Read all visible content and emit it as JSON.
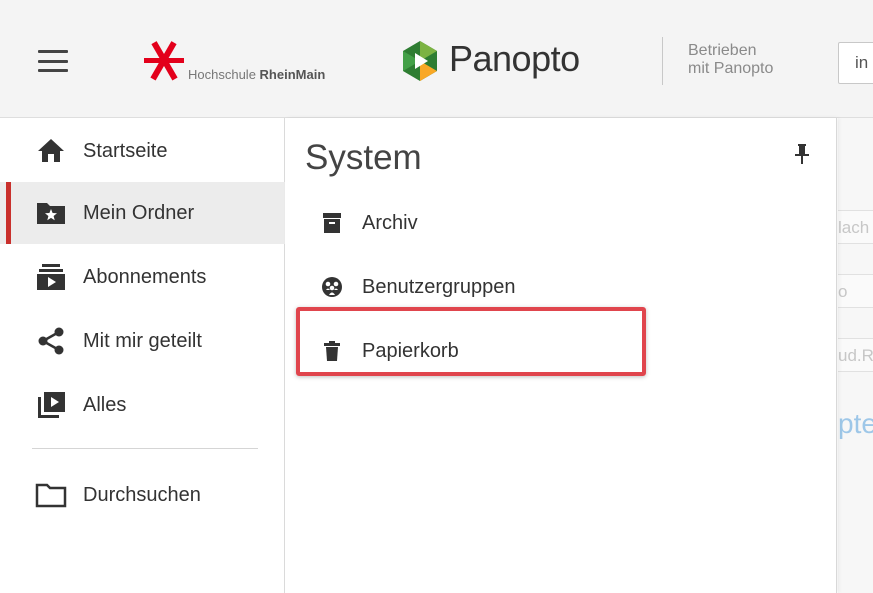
{
  "header": {
    "menu_icon": "hamburger-icon",
    "institution_logo": {
      "prefix": "Hochschule ",
      "name": "RheinMain",
      "mark_color": "#e3001b"
    },
    "brand": {
      "name": "Panopto",
      "colors": [
        "#2e7d32",
        "#7cb342",
        "#f9a825",
        "#43a047"
      ]
    },
    "powered_by_line1": "Betrieben",
    "powered_by_line2": "mit Panopto",
    "search_value": "in"
  },
  "sidebar": {
    "items": [
      {
        "label": "Startseite",
        "icon": "home-icon",
        "active": false
      },
      {
        "label": "Mein Ordner",
        "icon": "starred-folder-icon",
        "active": true
      },
      {
        "label": "Abonnements",
        "icon": "subscriptions-icon",
        "active": false
      },
      {
        "label": "Mit mir geteilt",
        "icon": "share-icon",
        "active": false
      },
      {
        "label": "Alles",
        "icon": "video-library-icon",
        "active": false
      },
      {
        "label": "Durchsuchen",
        "icon": "folder-outline-icon",
        "active": false
      }
    ],
    "active_accent": "#c9302c"
  },
  "panel": {
    "title": "System",
    "pin_icon": "pin-icon",
    "items": [
      {
        "label": "Archiv",
        "icon": "archive-icon"
      },
      {
        "label": "Benutzergruppen",
        "icon": "user-groups-icon"
      },
      {
        "label": "Papierkorb",
        "icon": "trash-icon",
        "highlighted": true
      }
    ],
    "highlight_color": "#e0454d"
  },
  "background": {
    "fragment_1": "lach",
    "fragment_2": "o",
    "fragment_3": "ud.R",
    "link_fragment": "pte"
  }
}
